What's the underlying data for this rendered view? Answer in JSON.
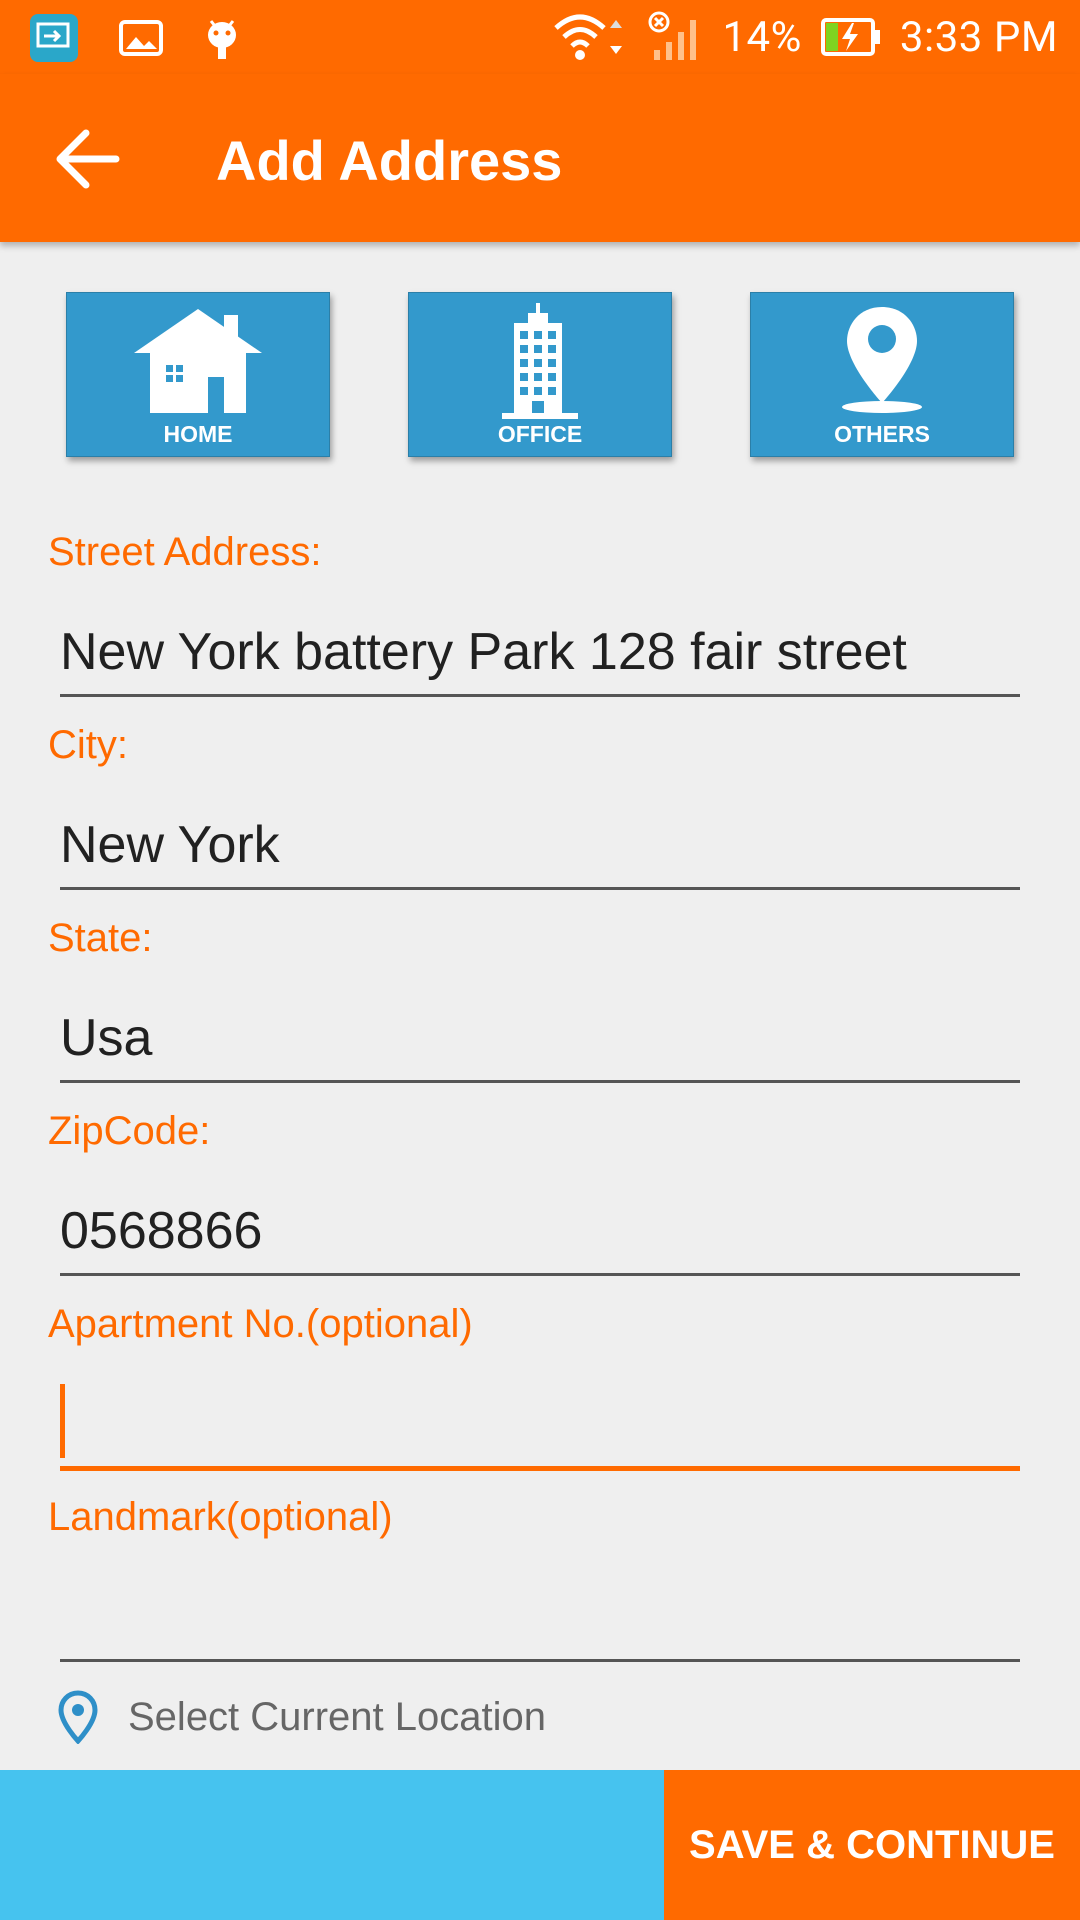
{
  "status_bar": {
    "battery": "14%",
    "time": "3:33 PM"
  },
  "app_bar": {
    "title": "Add Address"
  },
  "address_types": [
    {
      "label": "HOME"
    },
    {
      "label": "OFFICE"
    },
    {
      "label": "OTHERS"
    }
  ],
  "form": {
    "street_label": "Street Address:",
    "street_value": "New York battery Park 128 fair street",
    "city_label": "City:",
    "city_value": "New York",
    "state_label": "State:",
    "state_value": "Usa",
    "zip_label": "ZipCode:",
    "zip_value": "0568866",
    "apartment_label": "Apartment No.(optional)",
    "apartment_value": "",
    "landmark_label": "Landmark(optional)",
    "landmark_value": ""
  },
  "location": {
    "label": "Select Current Location"
  },
  "bottom": {
    "save_label": "SAVE & CONTINUE"
  },
  "colors": {
    "accent": "#ff6a00",
    "button_blue": "#3399cc",
    "bottom_blue": "#46c3ef"
  }
}
